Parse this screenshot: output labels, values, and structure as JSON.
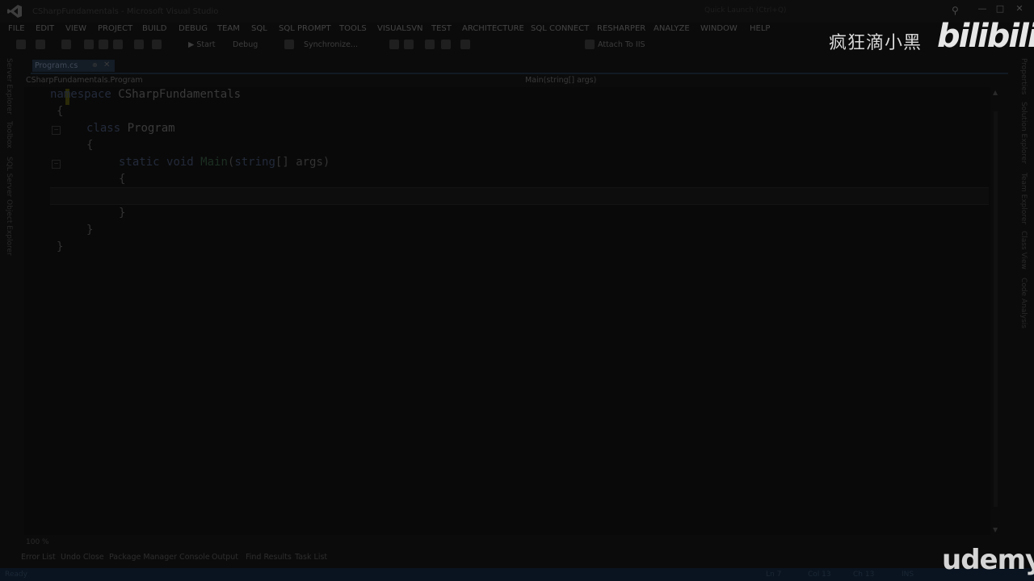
{
  "window": {
    "title": "CSharpFundamentals - Microsoft Visual Studio",
    "quick_launch": "Quick Launch (Ctrl+Q)",
    "buttons": {
      "minimize": "—",
      "maximize": "□",
      "close": "✕"
    }
  },
  "menu": [
    "FILE",
    "EDIT",
    "VIEW",
    "PROJECT",
    "BUILD",
    "DEBUG",
    "TEAM",
    "SQL",
    "SQL PROMPT",
    "TOOLS",
    "VISUALSVN",
    "TEST",
    "ARCHITECTURE",
    "SQL CONNECT",
    "RESHARPER",
    "ANALYZE",
    "WINDOW",
    "HELP"
  ],
  "toolbar": {
    "start": "Start",
    "config": "Debug",
    "sync": "Synchronize...",
    "attach": "Attach To IIS"
  },
  "left_rail": [
    "Server Explorer",
    "Toolbox",
    "SQL Server Object Explorer"
  ],
  "right_rail": [
    "Properties",
    "Solution Explorer",
    "Team Explorer",
    "Class View",
    "Code Analysis"
  ],
  "tab": {
    "label": "Program.cs",
    "pin": "⊕",
    "close": "✕"
  },
  "navbar": {
    "left": "CSharpFundamentals.Program",
    "right": "Main(string[] args)"
  },
  "code": {
    "line1": {
      "kw": "namespace",
      "name": "CSharpFundamentals"
    },
    "line2": "{",
    "line3": {
      "kw": "class",
      "name": "Program"
    },
    "line4": "{",
    "line5": {
      "kw1": "static",
      "kw2": "void",
      "method": "Main",
      "open": "(",
      "ptype": "string",
      "rest": "[] args)"
    },
    "line6": "{",
    "line8": "}",
    "line9": "}",
    "line10": "}"
  },
  "outline": {
    "collapse": "−"
  },
  "zoom": "100 %",
  "bottom_tabs": [
    "Error List",
    "Undo Close",
    "Package Manager Console",
    "Output",
    "Find Results",
    "Task List"
  ],
  "statusbar": {
    "left": "Ready",
    "ln": "Ln 7",
    "col": "Col 13",
    "ch": "Ch 13",
    "ins": "INS"
  },
  "watermarks": {
    "channel": "疯狂滴小黑",
    "bilibili": "bilibili",
    "udemy": "udemy"
  },
  "colors": {
    "background": "#0b0b0b",
    "tab_active": "#141c26",
    "statusbar": "#0a1420"
  }
}
